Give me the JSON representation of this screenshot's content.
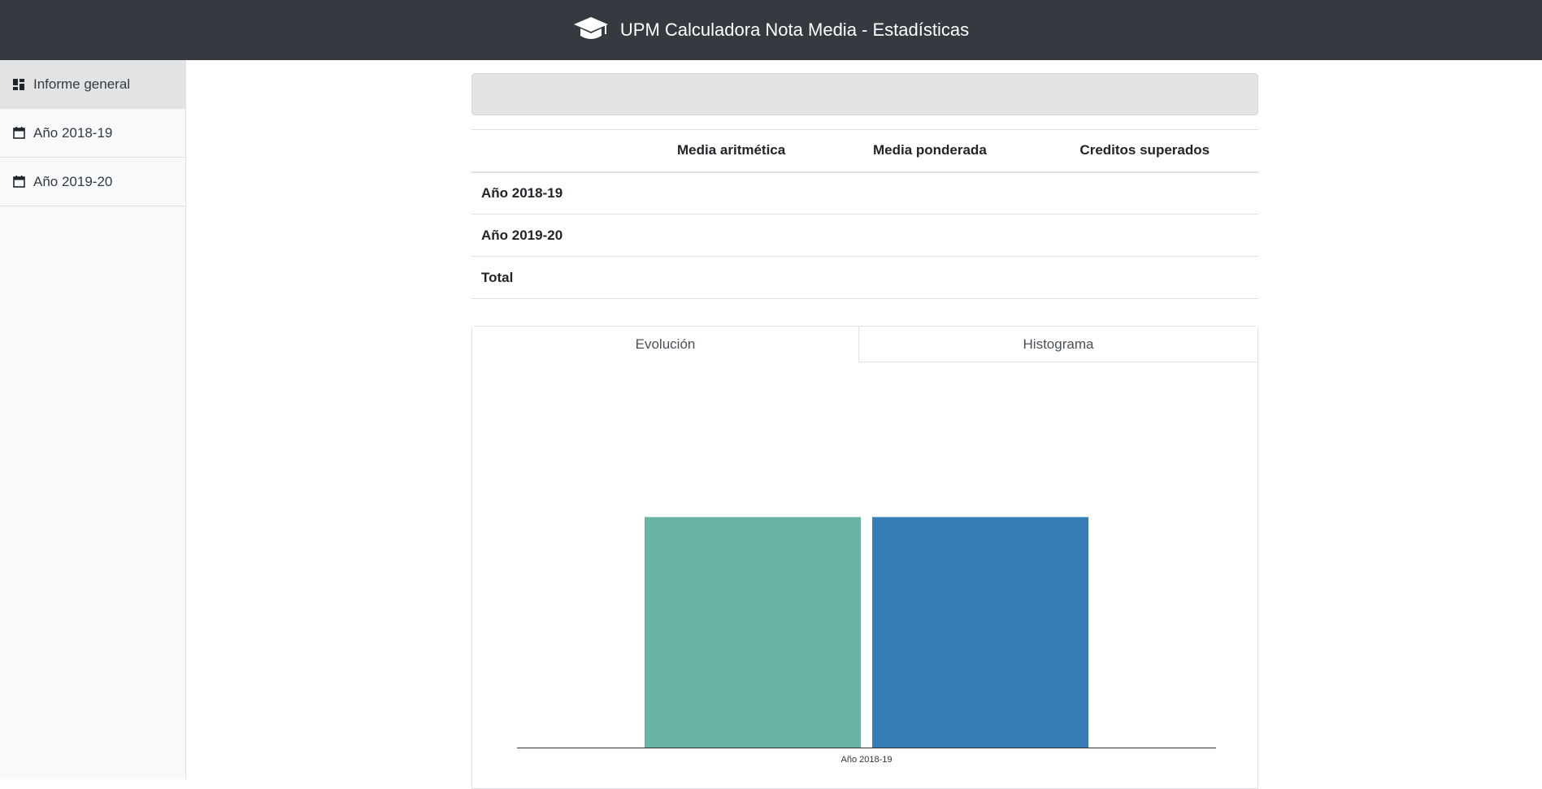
{
  "navbar": {
    "title": "UPM Calculadora Nota Media - Estadísticas",
    "icon": "graduation-cap-icon"
  },
  "sidebar": {
    "items": [
      {
        "label": "Informe general",
        "icon": "dashboard-icon",
        "active": true
      },
      {
        "label": "Año 2018-19",
        "icon": "calendar-icon",
        "active": false
      },
      {
        "label": "Año 2019-20",
        "icon": "calendar-icon",
        "active": false
      }
    ]
  },
  "table": {
    "headers": [
      "",
      "Media aritmética",
      "Media ponderada",
      "Creditos superados"
    ],
    "rows": [
      {
        "label": "Año 2018-19",
        "cells": [
          "",
          "",
          ""
        ]
      },
      {
        "label": "Año 2019-20",
        "cells": [
          "",
          "",
          ""
        ]
      },
      {
        "label": "Total",
        "cells": [
          "",
          "",
          ""
        ]
      }
    ]
  },
  "tabs": [
    {
      "label": "Evolución",
      "active": true
    },
    {
      "label": "Histograma",
      "active": false
    }
  ],
  "colors": {
    "navbar": "#343a40",
    "series_1": "#69b3a2",
    "series_2": "#377eb8"
  },
  "chart_data": {
    "type": "bar",
    "categories": [
      "Año 2018-19"
    ],
    "series": [
      {
        "values": [
          1
        ]
      },
      {
        "values": [
          1
        ]
      }
    ],
    "ylim": [
      0,
      1.53
    ],
    "grid": false
  }
}
